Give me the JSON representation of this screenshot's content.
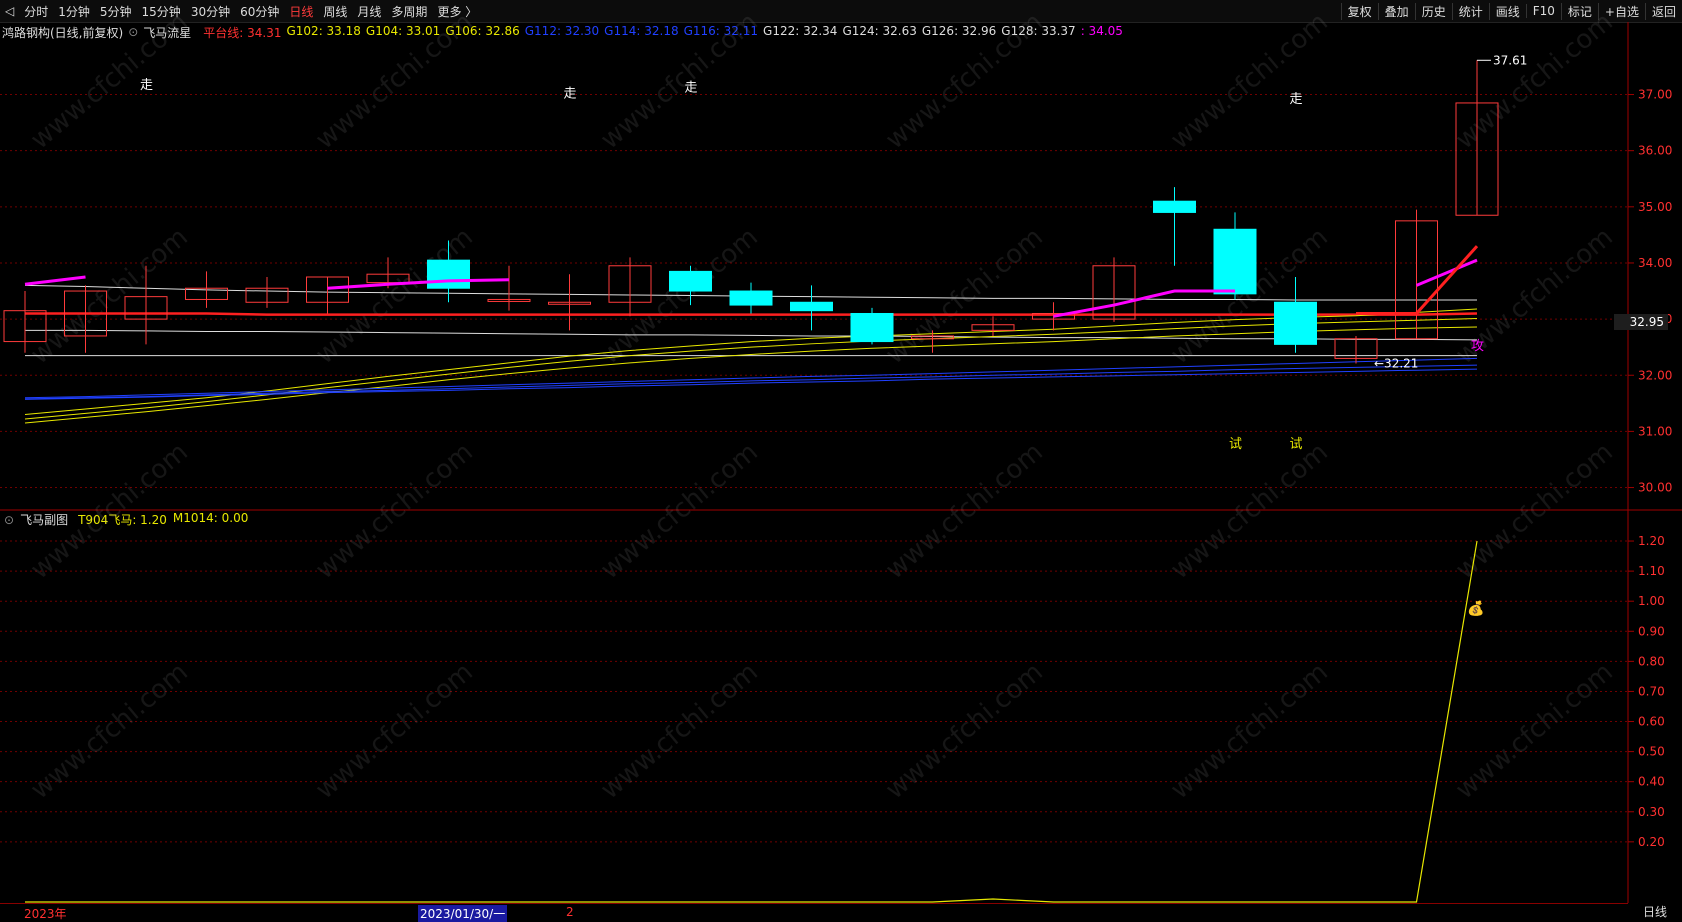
{
  "toolbar": {
    "back_glyph": "◁",
    "periods": [
      "分时",
      "1分钟",
      "5分钟",
      "15分钟",
      "30分钟",
      "60分钟",
      "日线",
      "周线",
      "月线",
      "多周期",
      "更多 〉"
    ],
    "active_period": "日线",
    "right_buttons": [
      "复权",
      "叠加",
      "历史",
      "统计",
      "画线",
      "F10",
      "标记",
      "+自选",
      "返回"
    ]
  },
  "main_legend": {
    "stock": "鸿路钢构(日线,前复权)",
    "indicator": "飞马流星",
    "items": [
      {
        "text": "平台线: 34.31",
        "color": "#ff3030"
      },
      {
        "text": "G102: 33.18",
        "color": "#e8e800"
      },
      {
        "text": "G104: 33.01",
        "color": "#e8e800"
      },
      {
        "text": "G106: 32.86",
        "color": "#e8e800"
      },
      {
        "text": "G112: 32.30",
        "color": "#2040ff"
      },
      {
        "text": "G114: 32.18",
        "color": "#2040ff"
      },
      {
        "text": "G116: 32.11",
        "color": "#2040ff"
      },
      {
        "text": "G122: 32.34",
        "color": "#dddddd"
      },
      {
        "text": "G124: 32.63",
        "color": "#dddddd"
      },
      {
        "text": "G126: 32.96",
        "color": "#dddddd"
      },
      {
        "text": "G128: 33.37",
        "color": "#dddddd"
      },
      {
        "text": ": 34.05",
        "color": "#ff00ff"
      }
    ]
  },
  "sub_legend": {
    "title": "飞马副图",
    "items": [
      {
        "text": "T904飞马: 1.20",
        "color": "#e8e800"
      },
      {
        "text": "M1014: 0.00",
        "color": "#e8e800"
      }
    ]
  },
  "chart_data": [
    {
      "type": "candlestick",
      "title": "鸿路钢构(日线,前复权)",
      "ylim": [
        29.6,
        37.9
      ],
      "y_ticks": [
        "30.00",
        "31.00",
        "32.00",
        "33.00",
        "34.00",
        "35.00",
        "36.00",
        "37.00"
      ],
      "current_price": "32.95",
      "high_label": "37.61",
      "low_label": "32.21",
      "candles": [
        {
          "o": 32.6,
          "h": 33.5,
          "l": 32.4,
          "c": 33.15
        },
        {
          "o": 32.7,
          "h": 33.6,
          "l": 32.4,
          "c": 33.5
        },
        {
          "o": 33.0,
          "h": 33.95,
          "l": 32.55,
          "c": 33.4
        },
        {
          "o": 33.35,
          "h": 33.85,
          "l": 33.2,
          "c": 33.55
        },
        {
          "o": 33.3,
          "h": 33.75,
          "l": 33.2,
          "c": 33.55
        },
        {
          "o": 33.3,
          "h": 33.75,
          "l": 33.1,
          "c": 33.75
        },
        {
          "o": 33.65,
          "h": 34.1,
          "l": 33.55,
          "c": 33.8
        },
        {
          "o": 34.05,
          "h": 34.4,
          "l": 33.3,
          "c": 33.55
        },
        {
          "o": 33.35,
          "h": 33.95,
          "l": 33.15,
          "c": 33.35
        },
        {
          "o": 33.3,
          "h": 33.8,
          "l": 32.8,
          "c": 33.3
        },
        {
          "o": 33.3,
          "h": 34.1,
          "l": 33.05,
          "c": 33.95
        },
        {
          "o": 33.85,
          "h": 33.95,
          "l": 33.25,
          "c": 33.5
        },
        {
          "o": 33.5,
          "h": 33.65,
          "l": 33.1,
          "c": 33.25
        },
        {
          "o": 33.3,
          "h": 33.6,
          "l": 32.8,
          "c": 33.15
        },
        {
          "o": 33.1,
          "h": 33.2,
          "l": 32.55,
          "c": 32.6
        },
        {
          "o": 32.65,
          "h": 32.8,
          "l": 32.4,
          "c": 32.7
        },
        {
          "o": 32.8,
          "h": 33.05,
          "l": 32.7,
          "c": 32.9
        },
        {
          "o": 33.0,
          "h": 33.3,
          "l": 32.8,
          "c": 33.1
        },
        {
          "o": 33.0,
          "h": 34.1,
          "l": 32.95,
          "c": 33.95
        },
        {
          "o": 35.1,
          "h": 35.35,
          "l": 33.95,
          "c": 34.9
        },
        {
          "o": 34.6,
          "h": 34.9,
          "l": 33.35,
          "c": 33.45
        },
        {
          "o": 33.3,
          "h": 33.75,
          "l": 32.4,
          "c": 32.55
        },
        {
          "o": 32.3,
          "h": 32.7,
          "l": 32.21,
          "c": 32.65
        },
        {
          "o": 32.65,
          "h": 34.95,
          "l": 32.65,
          "c": 34.75
        },
        {
          "o": 34.85,
          "h": 37.61,
          "l": 34.85,
          "c": 36.85
        }
      ],
      "ma_lines": [
        {
          "name": "平台线",
          "color": "#ff2020",
          "values": [
            33.1,
            33.1,
            33.1,
            33.1,
            33.08,
            33.08,
            33.08,
            33.08,
            33.08,
            33.08,
            33.08,
            33.08,
            33.08,
            33.08,
            33.08,
            33.08,
            33.08,
            33.08,
            33.08,
            33.08,
            33.08,
            33.08,
            33.08,
            33.08,
            33.1
          ]
        },
        {
          "name": "G122",
          "color": "#dddddd",
          "values": [
            33.6,
            33.58,
            33.55,
            33.52,
            33.5,
            33.48,
            33.47,
            33.46,
            33.45,
            33.44,
            33.43,
            33.42,
            33.41,
            33.4,
            33.39,
            33.38,
            33.37,
            33.37,
            33.36,
            33.35,
            33.35,
            33.34,
            33.34,
            33.34,
            33.34
          ]
        },
        {
          "name": "G124",
          "color": "#dddddd",
          "values": [
            32.8,
            32.8,
            32.79,
            32.78,
            32.78,
            32.77,
            32.76,
            32.75,
            32.74,
            32.73,
            32.72,
            32.72,
            32.71,
            32.7,
            32.7,
            32.69,
            32.68,
            32.67,
            32.67,
            32.66,
            32.65,
            32.65,
            32.64,
            32.64,
            32.63
          ]
        },
        {
          "name": "G126",
          "color": "#dddddd",
          "values": [
            32.35,
            32.35,
            32.35,
            32.35,
            32.35,
            32.35,
            32.35,
            32.35,
            32.35,
            32.35,
            32.35,
            32.35,
            32.35,
            32.35,
            32.35,
            32.35,
            32.35,
            32.35,
            32.35,
            32.35,
            32.35,
            32.35,
            32.35,
            32.35,
            32.35
          ]
        },
        {
          "name": "G102",
          "color": "#e8e800",
          "values": [
            31.3,
            31.4,
            31.5,
            31.6,
            31.72,
            31.85,
            31.98,
            32.1,
            32.22,
            32.34,
            32.44,
            32.52,
            32.6,
            32.66,
            32.7,
            32.74,
            32.78,
            32.82,
            32.88,
            32.94,
            32.99,
            33.03,
            33.06,
            33.12,
            33.18
          ]
        },
        {
          "name": "G104",
          "color": "#e8e800",
          "values": [
            31.22,
            31.32,
            31.42,
            31.53,
            31.65,
            31.78,
            31.9,
            32.02,
            32.14,
            32.25,
            32.35,
            32.43,
            32.5,
            32.56,
            32.61,
            32.65,
            32.69,
            32.73,
            32.78,
            32.83,
            32.88,
            32.92,
            32.95,
            32.98,
            33.01
          ]
        },
        {
          "name": "G106",
          "color": "#e8e800",
          "values": [
            31.15,
            31.25,
            31.35,
            31.46,
            31.57,
            31.69,
            31.8,
            31.92,
            32.03,
            32.13,
            32.22,
            32.3,
            32.37,
            32.43,
            32.48,
            32.52,
            32.56,
            32.6,
            32.65,
            32.7,
            32.74,
            32.78,
            32.81,
            32.84,
            32.86
          ]
        },
        {
          "name": "G112",
          "color": "#2040ff",
          "values": [
            31.6,
            31.62,
            31.65,
            31.68,
            31.71,
            31.74,
            31.77,
            31.8,
            31.83,
            31.86,
            31.89,
            31.92,
            31.95,
            31.98,
            32.0,
            32.03,
            32.06,
            32.09,
            32.12,
            32.15,
            32.18,
            32.21,
            32.24,
            32.27,
            32.3
          ]
        },
        {
          "name": "G114",
          "color": "#2040ff",
          "values": [
            31.58,
            31.6,
            31.62,
            31.65,
            31.68,
            31.71,
            31.73,
            31.76,
            31.79,
            31.82,
            31.85,
            31.87,
            31.9,
            31.92,
            31.95,
            31.97,
            32.0,
            32.02,
            32.05,
            32.07,
            32.1,
            32.12,
            32.14,
            32.16,
            32.18
          ]
        },
        {
          "name": "G116",
          "color": "#2040ff",
          "values": [
            31.57,
            31.59,
            31.61,
            31.64,
            31.66,
            31.69,
            31.71,
            31.73,
            31.76,
            31.78,
            31.81,
            31.83,
            31.86,
            31.88,
            31.9,
            31.93,
            31.95,
            31.97,
            31.99,
            32.01,
            32.03,
            32.05,
            32.07,
            32.09,
            32.11
          ]
        }
      ],
      "magenta_segments": [
        {
          "from": 0,
          "to": 1,
          "values": [
            33.62,
            33.75
          ]
        },
        {
          "from": 5,
          "to": 8,
          "values": [
            33.55,
            33.62,
            33.68,
            33.7
          ]
        },
        {
          "from": 17,
          "to": 20,
          "values": [
            33.05,
            33.25,
            33.5,
            33.5
          ]
        },
        {
          "from": 23,
          "to": 24,
          "values": [
            33.6,
            34.05
          ]
        }
      ],
      "red_segments": [
        {
          "from": 22,
          "to": 24,
          "values": [
            33.1,
            33.1,
            34.3
          ]
        }
      ],
      "markers": [
        {
          "index": 2,
          "text": "走",
          "price": 37.1,
          "color": "#ffffff"
        },
        {
          "index": 9,
          "text": "走",
          "price": 36.95,
          "color": "#ffffff"
        },
        {
          "index": 11,
          "text": "走",
          "price": 37.05,
          "color": "#ffffff"
        },
        {
          "index": 21,
          "text": "走",
          "price": 36.85,
          "color": "#ffffff"
        },
        {
          "index": 20,
          "text": "试",
          "price": 30.7,
          "color": "#e8e800"
        },
        {
          "index": 21,
          "text": "试",
          "price": 30.7,
          "color": "#e8e800"
        },
        {
          "index": 24,
          "text": "攻",
          "price": 32.45,
          "color": "#ff00ff"
        }
      ]
    },
    {
      "type": "line",
      "title": "飞马副图",
      "ylim": [
        0.0,
        1.25
      ],
      "y_ticks": [
        "0.20",
        "0.30",
        "0.40",
        "0.50",
        "0.60",
        "0.70",
        "0.80",
        "0.90",
        "1.00",
        "1.10",
        "1.20"
      ],
      "series": [
        {
          "name": "T904飞马",
          "color": "#e8e800",
          "values": [
            0,
            0,
            0,
            0,
            0,
            0,
            0,
            0,
            0,
            0,
            0,
            0,
            0,
            0,
            0,
            0,
            0.01,
            0,
            0,
            0,
            0,
            0,
            0,
            0,
            1.2
          ]
        }
      ],
      "marker": {
        "index": 24,
        "value": 0.98,
        "text": "💰"
      }
    }
  ],
  "dates": {
    "year_label": "2023年",
    "cursor_label": "2023/01/30/一",
    "tick_label": "2"
  },
  "period_label": "日线",
  "watermark": "www.cfchi.com"
}
